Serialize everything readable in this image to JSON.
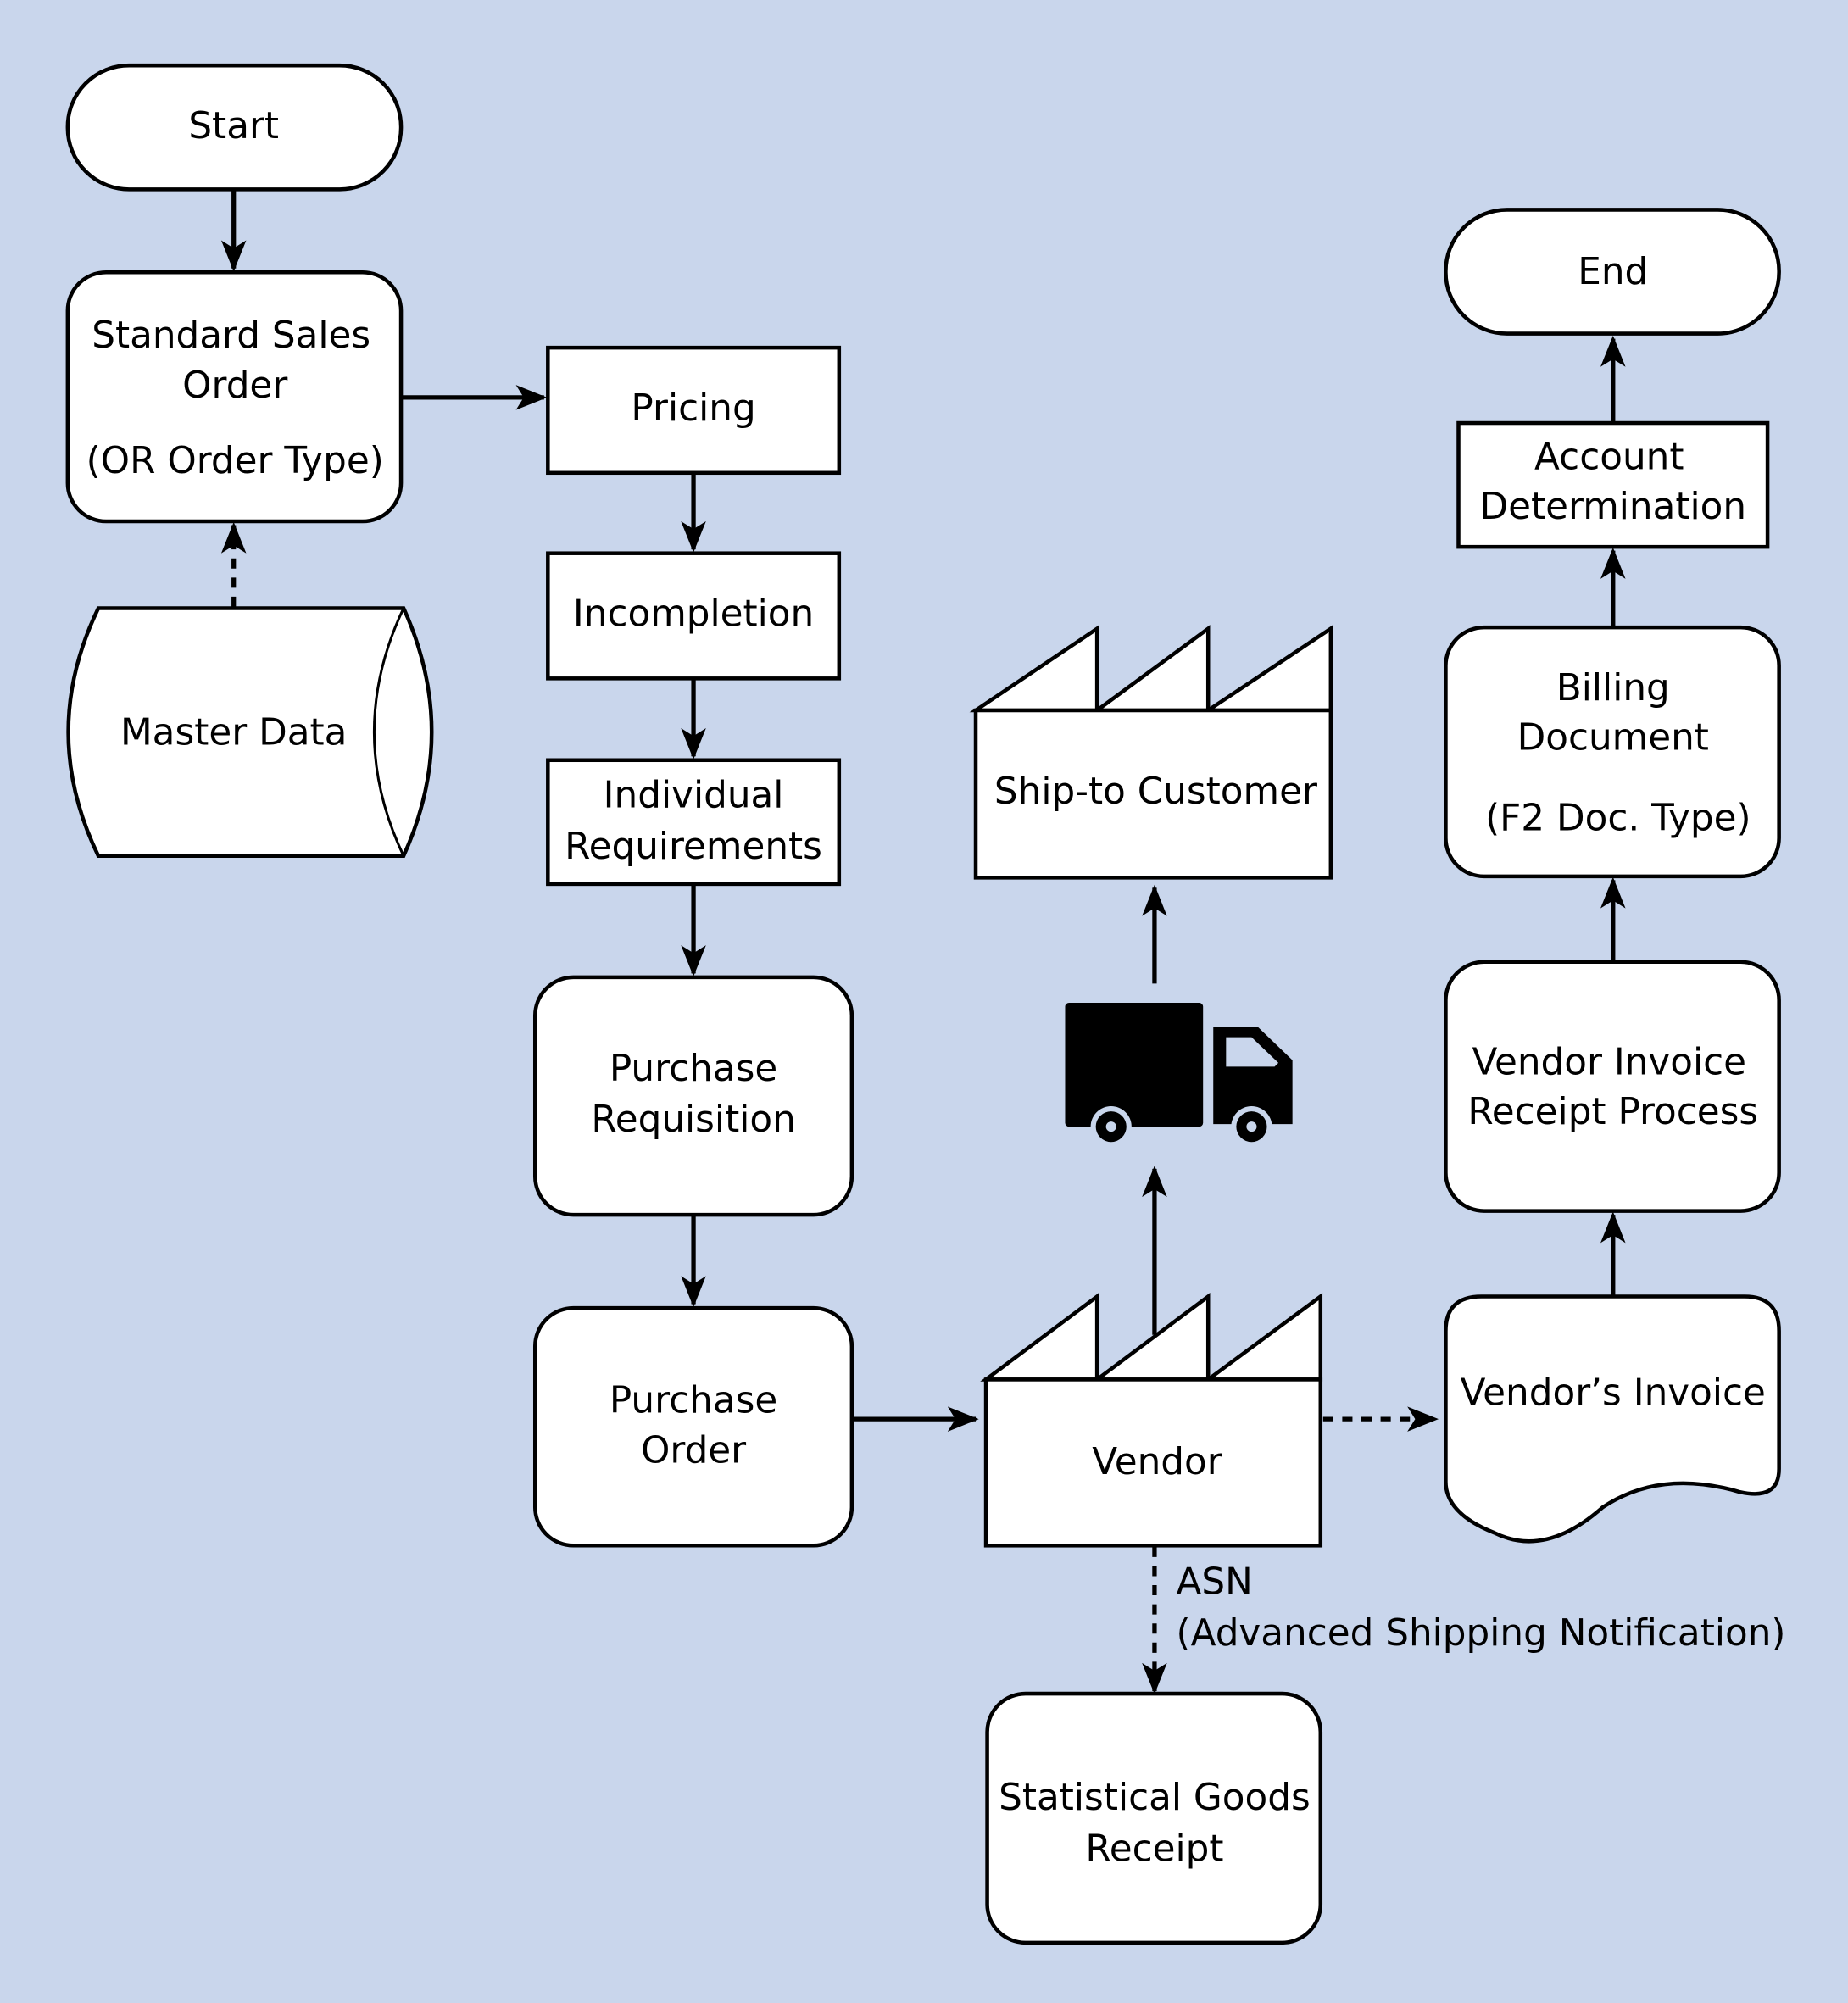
{
  "diagram": {
    "background_color": "#C9D6EC",
    "nodes": {
      "start": {
        "label": "Start"
      },
      "sales_order": {
        "line1": "Standard Sales",
        "line2": "Order",
        "line3": "(OR Order Type)"
      },
      "master_data": {
        "label": "Master Data"
      },
      "pricing": {
        "label": "Pricing"
      },
      "incompletion": {
        "label": "Incompletion"
      },
      "individual_requirements": {
        "line1": "Individual",
        "line2": "Requirements"
      },
      "purchase_requisition": {
        "line1": "Purchase",
        "line2": "Requisition"
      },
      "purchase_order": {
        "line1": "Purchase",
        "line2": "Order"
      },
      "vendor": {
        "label": "Vendor"
      },
      "ship_to_customer": {
        "label": "Ship-to Customer"
      },
      "statistical_goods_receipt": {
        "line1": "Statistical Goods",
        "line2": "Receipt"
      },
      "vendors_invoice": {
        "label": "Vendor’s Invoice"
      },
      "vendor_invoice_receipt": {
        "line1": "Vendor Invoice",
        "line2": "Receipt Process"
      },
      "billing_document": {
        "line1": "Billing",
        "line2": "Document",
        "line3": "(F2 Doc. Type)"
      },
      "account_determination": {
        "line1": "Account",
        "line2": "Determination"
      },
      "end": {
        "label": "End"
      }
    },
    "edges": {
      "asn_line1": "ASN",
      "asn_line2": "(Advanced Shipping Notification)"
    },
    "icons": {
      "truck": "delivery-truck-icon"
    }
  }
}
